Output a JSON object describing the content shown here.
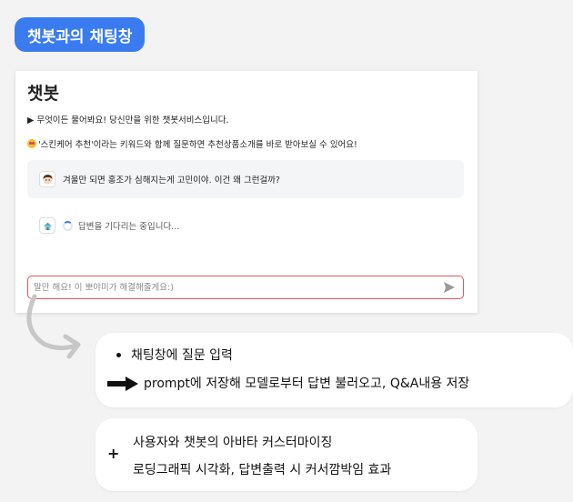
{
  "page_title": "챗봇과의 채팅창",
  "chat": {
    "heading": "챗봇",
    "intro_line": "▶ 무엇이든 물어봐요! 당신만을 위한 챗봇서비스입니다.",
    "hint_line": "'스킨케어 추천'이라는 키워드와 함께 질문하면 추천상품소개를 바로 받아보실 수 있어요!",
    "user_message": "겨울만 되면 홍조가 심해지는게 고민이야. 이건 왜 그런걸까?",
    "bot_status": "답변을 기다리는 중입니다...",
    "input_placeholder": "말만 해요! 이 뽀야미가 해결해줄게요:)"
  },
  "note_1": {
    "bullet": "채팅창에 질문 입력",
    "detail": "prompt에 저장해 모델로부터 답변 불러오고, Q&A내용 저장"
  },
  "note_2": {
    "line_1": "사용자와 챗봇의 아바타 커스터마이징",
    "line_2": "로딩그래픽 시각화, 답변출력 시 커서깜박임 효과"
  },
  "colors": {
    "accent": "#3a7cf0",
    "input_border": "#e0575c",
    "user_msg_bg": "#f4f5f7"
  },
  "icons": {
    "heart_eyes": "heart-eyes-emoji",
    "user_avatar": "user-avatar-icon",
    "bot_avatar": "bot-avatar-icon",
    "spinner": "loading-spinner-icon",
    "send": "send-icon",
    "arrow": "right-arrow-icon",
    "curve": "curved-arrow-icon"
  }
}
